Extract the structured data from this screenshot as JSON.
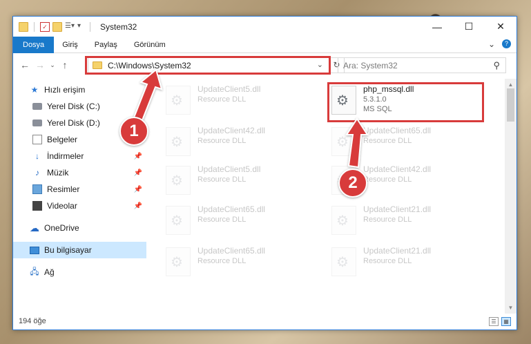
{
  "window": {
    "title": "System32",
    "controls": {
      "minimize": "—",
      "maximize": "☐",
      "close": "✕"
    }
  },
  "ribbon": {
    "tabs": [
      "Dosya",
      "Giriş",
      "Paylaş",
      "Görünüm"
    ],
    "expand_icon": "chevron-down-icon",
    "help_icon": "help-icon"
  },
  "addressbar": {
    "path": "C:\\Windows\\System32",
    "search_placeholder": "Ara: System32"
  },
  "sidebar": {
    "items": [
      {
        "label": "Hızlı erişim",
        "icon": "star-icon",
        "pinned": false
      },
      {
        "label": "Yerel Disk (C:)",
        "icon": "disk-icon",
        "pinned": false
      },
      {
        "label": "Yerel Disk (D:)",
        "icon": "disk-icon",
        "pinned": false
      },
      {
        "label": "Belgeler",
        "icon": "document-icon",
        "pinned": false
      },
      {
        "label": "İndirmeler",
        "icon": "download-icon",
        "pinned": true
      },
      {
        "label": "Müzik",
        "icon": "music-icon",
        "pinned": true
      },
      {
        "label": "Resimler",
        "icon": "pictures-icon",
        "pinned": true
      },
      {
        "label": "Videolar",
        "icon": "video-icon",
        "pinned": true
      },
      {
        "label": "OneDrive",
        "icon": "cloud-icon",
        "pinned": false
      },
      {
        "label": "Bu bilgisayar",
        "icon": "computer-icon",
        "pinned": false,
        "selected": true
      },
      {
        "label": "Ağ",
        "icon": "network-icon",
        "pinned": false
      }
    ]
  },
  "files": [
    {
      "name": "UpdateClient5.dll",
      "desc": "Resource DLL",
      "faded": true
    },
    {
      "name": "php_mssql.dll",
      "desc": "5.3.1.0",
      "desc2": "MS SQL",
      "faded": false,
      "highlighted": true
    },
    {
      "name": "UpdateClient42.dll",
      "desc": "Resource DLL",
      "faded": true
    },
    {
      "name": "UpdateClient65.dll",
      "desc": "Resource DLL",
      "faded": true
    },
    {
      "name": "UpdateClient5.dll",
      "desc": "Resource DLL",
      "faded": true
    },
    {
      "name": "UpdateClient42.dll",
      "desc": "Resource DLL",
      "faded": true
    },
    {
      "name": "UpdateClient65.dll",
      "desc": "Resource DLL",
      "faded": true
    },
    {
      "name": "UpdateClient21.dll",
      "desc": "Resource DLL",
      "faded": true
    },
    {
      "name": "UpdateClient65.dll",
      "desc": "Resource DLL",
      "faded": true
    },
    {
      "name": "UpdateClient21.dll",
      "desc": "Resource DLL",
      "faded": true
    }
  ],
  "status": {
    "count": "194 öğe"
  },
  "callouts": {
    "one": "1",
    "two": "2",
    "color": "#d83b3b"
  }
}
